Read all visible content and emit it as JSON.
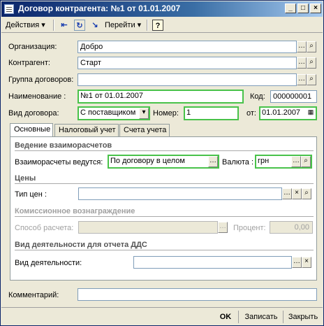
{
  "window": {
    "title": "Договор контрагента: №1 от 01.01.2007"
  },
  "toolbar": {
    "actions_label": "Действия",
    "goto_label": "Перейти",
    "help_label": "?"
  },
  "header": {
    "organization": {
      "label": "Организация:",
      "value": "Добро"
    },
    "counterparty": {
      "label": "Контрагент:",
      "value": "Старт"
    },
    "contract_group": {
      "label": "Группа договоров:",
      "value": ""
    },
    "name": {
      "label": "Наименование :",
      "value": "№1 от 01.01.2007"
    },
    "code": {
      "label": "Код:",
      "value": "000000001"
    },
    "contract_type": {
      "label": "Вид договора:",
      "value": "С поставщиком"
    },
    "number": {
      "label": "Номер:",
      "value": "1"
    },
    "date": {
      "label": "от:",
      "value": "01.01.2007"
    }
  },
  "tabs": [
    {
      "label": "Основные"
    },
    {
      "label": "Налоговый учет"
    },
    {
      "label": "Счета учета"
    }
  ],
  "main": {
    "settlements_section": "Ведение взаиморасчетов",
    "settlements": {
      "label": "Взаиморасчеты ведутся:",
      "value": "По договору в целом"
    },
    "currency": {
      "label": "Валюта :",
      "value": "грн"
    },
    "prices_section": "Цены",
    "price_type": {
      "label": "Тип цен :",
      "value": ""
    },
    "commission_section": "Комиссионное вознаграждение",
    "calc_method": {
      "label": "Способ расчета:",
      "value": ""
    },
    "percent": {
      "label": "Процент:",
      "value": "0,00"
    },
    "dds_section": "Вид деятельности для отчета ДДС",
    "activity_type": {
      "label": "Вид деятельности:",
      "value": ""
    }
  },
  "comment": {
    "label": "Комментарий:",
    "value": ""
  },
  "bottom": {
    "ok_label": "OK",
    "save_label": "Записать",
    "close_label": "Закрыть"
  },
  "icons": {
    "ellipsis": "…",
    "search": "magnifier-icon",
    "clear": "×"
  },
  "colors": {
    "required_border": "#49c24a",
    "title_bar": "#0a246a"
  }
}
